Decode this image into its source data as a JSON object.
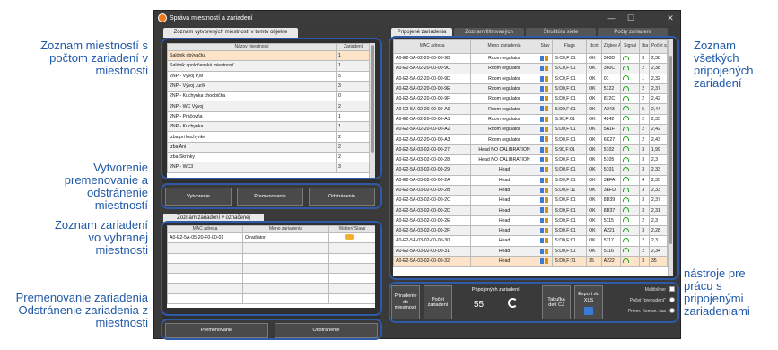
{
  "window": {
    "title": "Správa miestností a zariadení",
    "min": "—",
    "max": "☐",
    "close": "✕"
  },
  "left": {
    "tab": "Zoznam vytvorených miestností v tomto objekte",
    "rooms_headers": [
      "Názov miestnosti",
      "Zariadení"
    ],
    "rooms": [
      [
        "Salónik obývačka",
        "1"
      ],
      [
        "Salónik spoločenská miestnosť",
        "1"
      ],
      [
        "2NP - Vývoj P,M",
        "5"
      ],
      [
        "2NP - Vývoj Jurík",
        "3"
      ],
      [
        "2NP - Kuchynka chodbička",
        "0"
      ],
      [
        "2NP - WC Vývoj",
        "2"
      ],
      [
        "2NP - Práčovňa",
        "1"
      ],
      [
        "2NP - Kuchynka",
        "1"
      ],
      [
        "izba pri kuchynke",
        "2"
      ],
      [
        "izba Ani",
        "2"
      ],
      [
        "izba Skrinky",
        "2"
      ],
      [
        "2NP - WC3",
        "3"
      ]
    ],
    "btn_create": "Vytvorenie",
    "btn_rename": "Premenovanie",
    "btn_delete": "Odstránenie",
    "tab2": "Zoznam zariadení v označenej",
    "dev_headers": [
      "MAC adresa",
      "Meno zariadenia",
      "Watter/ Slave"
    ],
    "devices": [
      [
        "A0-E2-5A-05-20-F0-00-01",
        "Olradiator"
      ]
    ],
    "btn_rename2": "Premenovanie",
    "btn_delete2": "Odstránenie"
  },
  "right": {
    "tabs": [
      "Pripojené zariadenia",
      "Zoznam filtrovaných",
      "Štruktúra siete",
      "Počty zariadení"
    ],
    "headers": [
      "MAC adresa",
      "Meno zariadenia",
      "Stav",
      "Flags",
      "dcnt",
      "Zigbee Adresa",
      "Signál",
      "Iba v",
      "Počet správ"
    ],
    "rows": [
      [
        "A0-E2-5A-02-20-00-00-9B",
        "Room regulator",
        "S:C0,F:01",
        "OK",
        "360D",
        "3",
        "2,38"
      ],
      [
        "A0-E2-5A-02-20-00-00-9C",
        "Room regulator",
        "S:C0,F:01",
        "OK",
        "360C",
        "2",
        "2,38"
      ],
      [
        "A0-E2-5A-02-20-00-00-9D",
        "Room regulator",
        "S:C0,F:01",
        "OK",
        "01",
        "1",
        "2,32"
      ],
      [
        "A0-E2-5A-02-20-00-00-9E",
        "Room regulator",
        "S:D0,F:01",
        "OK",
        "5122",
        "2",
        "2,37"
      ],
      [
        "A0-E2-5A-02-20-00-00-9F",
        "Room regulator",
        "S:D0,F:01",
        "OK",
        "872C",
        "2",
        "2,42"
      ],
      [
        "A0-E2-5A-02-20-00-00-A0",
        "Room regulator",
        "S:D0,F:01",
        "OK",
        "A243",
        "5",
        "2,44"
      ],
      [
        "A0-E2-5A-02-20-00-00-A1",
        "Room regulator",
        "S:90,F:01",
        "OK",
        "4242",
        "2",
        "2,35"
      ],
      [
        "A0-E2-5A-02-20-00-00-A2",
        "Room regulator",
        "S:D0,F:01",
        "OK",
        "5A1F",
        "2",
        "2,42"
      ],
      [
        "A0-E2-5A-02-20-00-00-A3",
        "Room regulator",
        "S:D0,F:01",
        "OK",
        "6C27",
        "2",
        "2,43"
      ],
      [
        "A0-E2-5A-03-02-00-00-27",
        "Head NO CALIBRATION",
        "S:90,F:01",
        "OK",
        "5102",
        "3",
        "1,99"
      ],
      [
        "A0-E2-5A-03-02-00-00-28",
        "Head NO CALIBRATION",
        "S:D0,F:01",
        "OK",
        "5105",
        "3",
        "2,3"
      ],
      [
        "A0-E2-5A-03-02-00-00-29",
        "Head",
        "S:D0,F:01",
        "OK",
        "5101",
        "3",
        "2,33"
      ],
      [
        "A0-E2-5A-03-02-00-00-2A",
        "Head",
        "S:D0,F:01",
        "OK",
        "3EFA",
        "4",
        "2,35"
      ],
      [
        "A0-E2-5A-03-02-00-00-2B",
        "Head",
        "S:D0,F:11",
        "OK",
        "3EFD",
        "3",
        "2,33"
      ],
      [
        "A0-E2-5A-03-02-00-00-2C",
        "Head",
        "S:D0,F:01",
        "OK",
        "8D39",
        "3",
        "2,37"
      ],
      [
        "A0-E2-5A-03-02-00-00-2D",
        "Head",
        "S:D0,F:01",
        "OK",
        "8D37",
        "3",
        "2,31"
      ],
      [
        "A0-E2-5A-03-02-00-00-2E",
        "Head",
        "S:D0,F:01",
        "OK",
        "5115",
        "2",
        "2,3"
      ],
      [
        "A0-E2-5A-03-02-00-00-2F",
        "Head",
        "S:D0,F:01",
        "OK",
        "A221",
        "3",
        "2,28"
      ],
      [
        "A0-E2-5A-03-02-00-00-30",
        "Head",
        "S:D0,F:01",
        "OK",
        "5117",
        "2",
        "2,3"
      ],
      [
        "A0-E2-5A-03-02-00-00-31",
        "Head",
        "S:D0,F:01",
        "OK",
        "5116",
        "2",
        "2,34"
      ],
      [
        "A0-E2-5A-03-02-00-00-32",
        "Head",
        "S:D0,F:71",
        "35",
        "A222",
        "3",
        "35"
      ]
    ],
    "btn_assign": "Priradenie do miestnosti",
    "btn_count": "Počet zariadení",
    "connected_label": "Pripojených zariadení:",
    "connected_value": "55",
    "refresh_icon": "refresh-icon",
    "btn_table": "Tabuľka detí CJ",
    "btn_export": "Export do XLS",
    "opt_multi": "Multiběher",
    "opt_count": "Počet \"prebudení\"",
    "opt_avg": "Priem. Komun. čas"
  },
  "notes": {
    "n1": "Zoznam miestností s počtom zariadení v miestnosti",
    "n2": "Vytvorenie premenovanie a odstránenie miestností",
    "n3": "Zoznam zariadení vo vybranej miestnosti",
    "n4": "Premenovanie zariadenia Odstránenie zariadenia z miestnosti",
    "n5": "Zoznam všetkých pripojených zariadení",
    "n6": "nástroje pre prácu s pripojenými zariadeniami"
  }
}
